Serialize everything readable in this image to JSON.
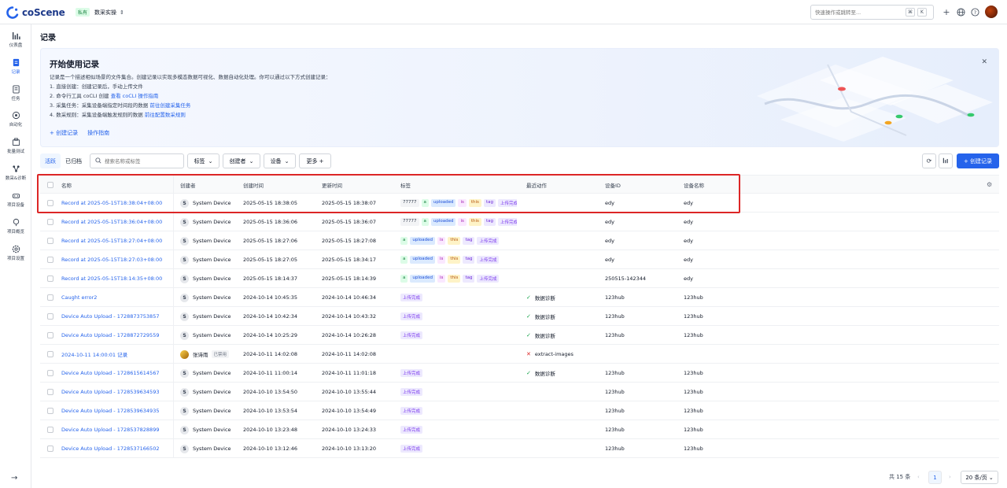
{
  "header": {
    "logo_text": "coScene",
    "badge": "私有",
    "project": "数采实操",
    "search_placeholder": "快速操作或跳转至...",
    "kbd_cmd": "⌘",
    "kbd_k": "K"
  },
  "sidebar": {
    "items": [
      {
        "label": "仪表盘",
        "icon": "dashboard-icon"
      },
      {
        "label": "记录",
        "icon": "record-icon"
      },
      {
        "label": "任务",
        "icon": "task-icon"
      },
      {
        "label": "自动化",
        "icon": "automation-icon"
      },
      {
        "label": "批量测试",
        "icon": "batch-test-icon"
      },
      {
        "label": "数采&诊断",
        "icon": "diagnosis-icon"
      },
      {
        "label": "项目设备",
        "icon": "device-icon"
      },
      {
        "label": "项目概览",
        "icon": "overview-icon"
      },
      {
        "label": "项目设置",
        "icon": "settings-icon"
      }
    ]
  },
  "page": {
    "title": "记录"
  },
  "banner": {
    "title": "开始使用记录",
    "intro": "记录是一个描述相似场景的文件集合。创建记录以实现多模态数据可视化、数据自动化处理。你可以通过以下方式创建记录：",
    "line1": "1. 直接创建：创建记录后，手动上传文件",
    "line2_a": "2. 命令行工具 coCLI 创建",
    "line2_link": "查看 coCLI 操作指南",
    "line3_a": "3. 采集任务：采集设备端指定时间段的数据",
    "line3_link": "前往创建采集任务",
    "line4_a": "4. 数采规则：采集设备端触发规则的数据",
    "line4_link": "前往配置数采规则",
    "create_link": "+ 创建记录",
    "guide_link": "操作指南"
  },
  "toolbar": {
    "tab_active": "活跃",
    "tab_archived": "已归档",
    "search_placeholder": "搜索名称或标签",
    "filter_tags": "标签",
    "filter_creator": "创建者",
    "filter_device": "设备",
    "more": "更多 +",
    "create": "+ 创建记录"
  },
  "table": {
    "columns": [
      "名称",
      "创建者",
      "创建时间",
      "更新时间",
      "标签",
      "最近动作",
      "设备ID",
      "设备名称"
    ],
    "rows": [
      {
        "name": "Record at 2025-05-15T18:38:04+08:00",
        "creator": "System Device",
        "created": "2025-05-15 18:38:05",
        "updated": "2025-05-15 18:38:07",
        "tags": [
          "77777",
          "a",
          "uploaded",
          "is",
          "this",
          "tag",
          "上传完成"
        ],
        "action": "",
        "action_status": "",
        "device_id": "edy",
        "device_name": "edy"
      },
      {
        "name": "Record at 2025-05-15T18:36:04+08:00",
        "creator": "System Device",
        "created": "2025-05-15 18:36:06",
        "updated": "2025-05-15 18:36:07",
        "tags": [
          "77777",
          "a",
          "uploaded",
          "is",
          "this",
          "tag",
          "上传完成"
        ],
        "action": "",
        "action_status": "",
        "device_id": "edy",
        "device_name": "edy"
      },
      {
        "name": "Record at 2025-05-15T18:27:04+08:00",
        "creator": "System Device",
        "created": "2025-05-15 18:27:06",
        "updated": "2025-05-15 18:27:08",
        "tags": [
          "a",
          "uploaded",
          "is",
          "this",
          "tag",
          "上传完成"
        ],
        "action": "",
        "action_status": "",
        "device_id": "edy",
        "device_name": "edy"
      },
      {
        "name": "Record at 2025-05-15T18:27:03+08:00",
        "creator": "System Device",
        "created": "2025-05-15 18:27:05",
        "updated": "2025-05-15 18:34:17",
        "tags": [
          "a",
          "uploaded",
          "is",
          "this",
          "tag",
          "上传完成"
        ],
        "action": "",
        "action_status": "",
        "device_id": "edy",
        "device_name": "edy"
      },
      {
        "name": "Record at 2025-05-15T18:14:35+08:00",
        "creator": "System Device",
        "created": "2025-05-15 18:14:37",
        "updated": "2025-05-15 18:14:39",
        "tags": [
          "a",
          "uploaded",
          "is",
          "this",
          "tag",
          "上传完成"
        ],
        "action": "",
        "action_status": "",
        "device_id": "250515-142344",
        "device_name": "edy"
      },
      {
        "name": "Caught error2",
        "creator": "System Device",
        "created": "2024-10-14 10:45:35",
        "updated": "2024-10-14 10:46:34",
        "tags": [
          "上传完成"
        ],
        "action": "数据诊断",
        "action_status": "ok",
        "device_id": "123hub",
        "device_name": "123hub"
      },
      {
        "name": "Device Auto Upload - 1728873753857",
        "creator": "System Device",
        "created": "2024-10-14 10:42:34",
        "updated": "2024-10-14 10:43:32",
        "tags": [
          "上传完成"
        ],
        "action": "数据诊断",
        "action_status": "ok",
        "device_id": "123hub",
        "device_name": "123hub"
      },
      {
        "name": "Device Auto Upload - 1728872729559",
        "creator": "System Device",
        "created": "2024-10-14 10:25:29",
        "updated": "2024-10-14 10:26:28",
        "tags": [
          "上传完成"
        ],
        "action": "数据诊断",
        "action_status": "ok",
        "device_id": "123hub",
        "device_name": "123hub"
      },
      {
        "name": "2024-10-11 14:00:01 记录",
        "creator": "张诗雨",
        "creator_badge": "已禁用",
        "created": "2024-10-11 14:02:08",
        "updated": "2024-10-11 14:02:08",
        "tags": [],
        "action": "extract-images",
        "action_status": "fail",
        "device_id": "",
        "device_name": ""
      },
      {
        "name": "Device Auto Upload - 1728615614567",
        "creator": "System Device",
        "created": "2024-10-11 11:00:14",
        "updated": "2024-10-11 11:01:18",
        "tags": [
          "上传完成"
        ],
        "action": "数据诊断",
        "action_status": "ok",
        "device_id": "123hub",
        "device_name": "123hub"
      },
      {
        "name": "Device Auto Upload - 1728539634593",
        "creator": "System Device",
        "created": "2024-10-10 13:54:50",
        "updated": "2024-10-10 13:55:44",
        "tags": [
          "上传完成"
        ],
        "action": "",
        "action_status": "",
        "device_id": "123hub",
        "device_name": "123hub"
      },
      {
        "name": "Device Auto Upload - 1728539634935",
        "creator": "System Device",
        "created": "2024-10-10 13:53:54",
        "updated": "2024-10-10 13:54:49",
        "tags": [
          "上传完成"
        ],
        "action": "",
        "action_status": "",
        "device_id": "123hub",
        "device_name": "123hub"
      },
      {
        "name": "Device Auto Upload - 1728537828899",
        "creator": "System Device",
        "created": "2024-10-10 13:23:48",
        "updated": "2024-10-10 13:24:33",
        "tags": [
          "上传完成"
        ],
        "action": "",
        "action_status": "",
        "device_id": "123hub",
        "device_name": "123hub"
      },
      {
        "name": "Device Auto Upload - 1728537166502",
        "creator": "System Device",
        "created": "2024-10-10 13:12:46",
        "updated": "2024-10-10 13:13:20",
        "tags": [
          "上传完成"
        ],
        "action": "",
        "action_status": "",
        "device_id": "123hub",
        "device_name": "123hub"
      }
    ]
  },
  "pagination": {
    "total": "共 15 条",
    "page": "1",
    "prev": "‹",
    "next": "›",
    "page_size": "20 条/页"
  },
  "colors": {
    "accent": "#2563eb",
    "highlight": "#dc2626"
  }
}
